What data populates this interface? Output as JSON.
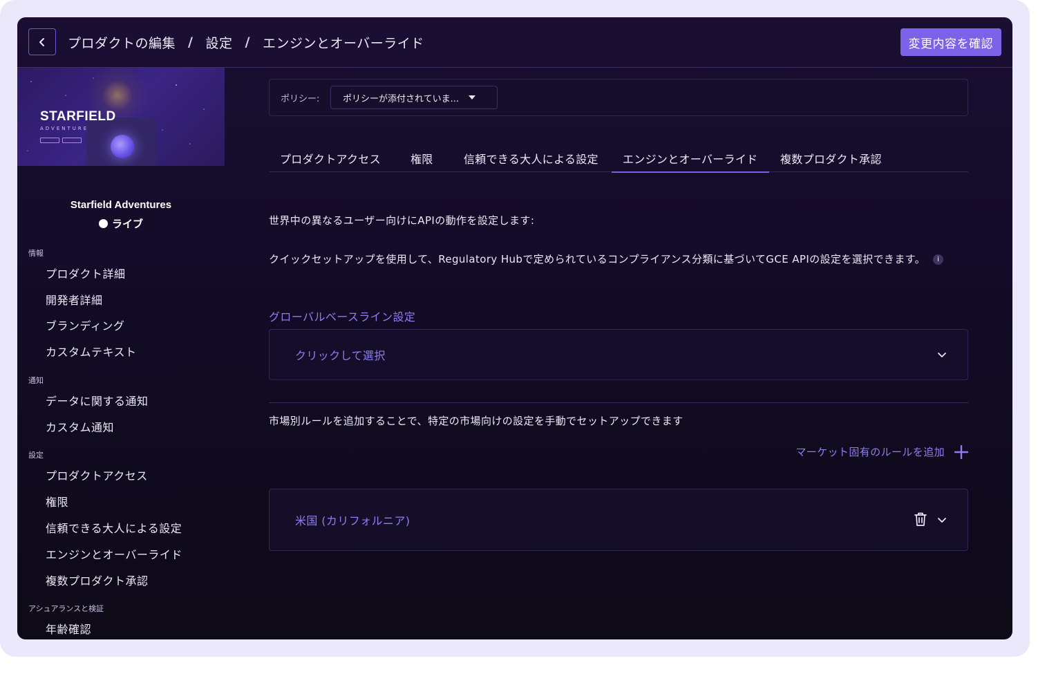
{
  "header": {
    "breadcrumb": [
      "プロダクトの編集",
      "設定",
      "エンジンとオーバーライド"
    ],
    "separator": "/",
    "confirm_label": "変更内容を確認"
  },
  "sidebar": {
    "hero": {
      "title": "STARFIELD",
      "subtitle": "ADVENTURE"
    },
    "product_name": "Starfield Adventures",
    "status": "ライブ",
    "sections": [
      {
        "title": "情報",
        "items": [
          "プロダクト詳細",
          "開発者詳細",
          "ブランディング",
          "カスタムテキスト"
        ]
      },
      {
        "title": "通知",
        "items": [
          "データに関する通知",
          "カスタム通知"
        ]
      },
      {
        "title": "設定",
        "items": [
          "プロダクトアクセス",
          "権限",
          "信頼できる大人による設定",
          "エンジンとオーバーライド",
          "複数プロダクト承認"
        ]
      },
      {
        "title": "アシュアランスと検証",
        "items": [
          "年齢確認"
        ]
      }
    ]
  },
  "main": {
    "policy": {
      "label": "ポリシー:",
      "value": "ポリシーが添付されていま..."
    },
    "tabs": [
      {
        "label": "プロダクトアクセス",
        "active": false
      },
      {
        "label": "権限",
        "active": false
      },
      {
        "label": "信頼できる大人による設定",
        "active": false
      },
      {
        "label": "エンジンとオーバーライド",
        "active": true
      },
      {
        "label": "複数プロダクト承認",
        "active": false
      }
    ],
    "intro": "世界中の異なるユーザー向けにAPIの動作を設定します:",
    "quick_setup": "クイックセットアップを使用して、Regulatory Hubで定められているコンプライアンス分類に基づいてGCE APIの設定を選択できます。",
    "baseline_title": "グローバルベースライン設定",
    "baseline_placeholder": "クリックして選択",
    "market_text": "市場別ルールを追加することで、特定の市場向けの設定を手動でセットアップできます",
    "add_rule_label": "マーケット固有のルールを追加",
    "rules": [
      {
        "label": "米国 (カリフォルニア)"
      }
    ]
  },
  "colors": {
    "accent": "#7b63e8",
    "link": "#8f7ef0",
    "background": "#130b26",
    "frame": "#ece8fb"
  }
}
